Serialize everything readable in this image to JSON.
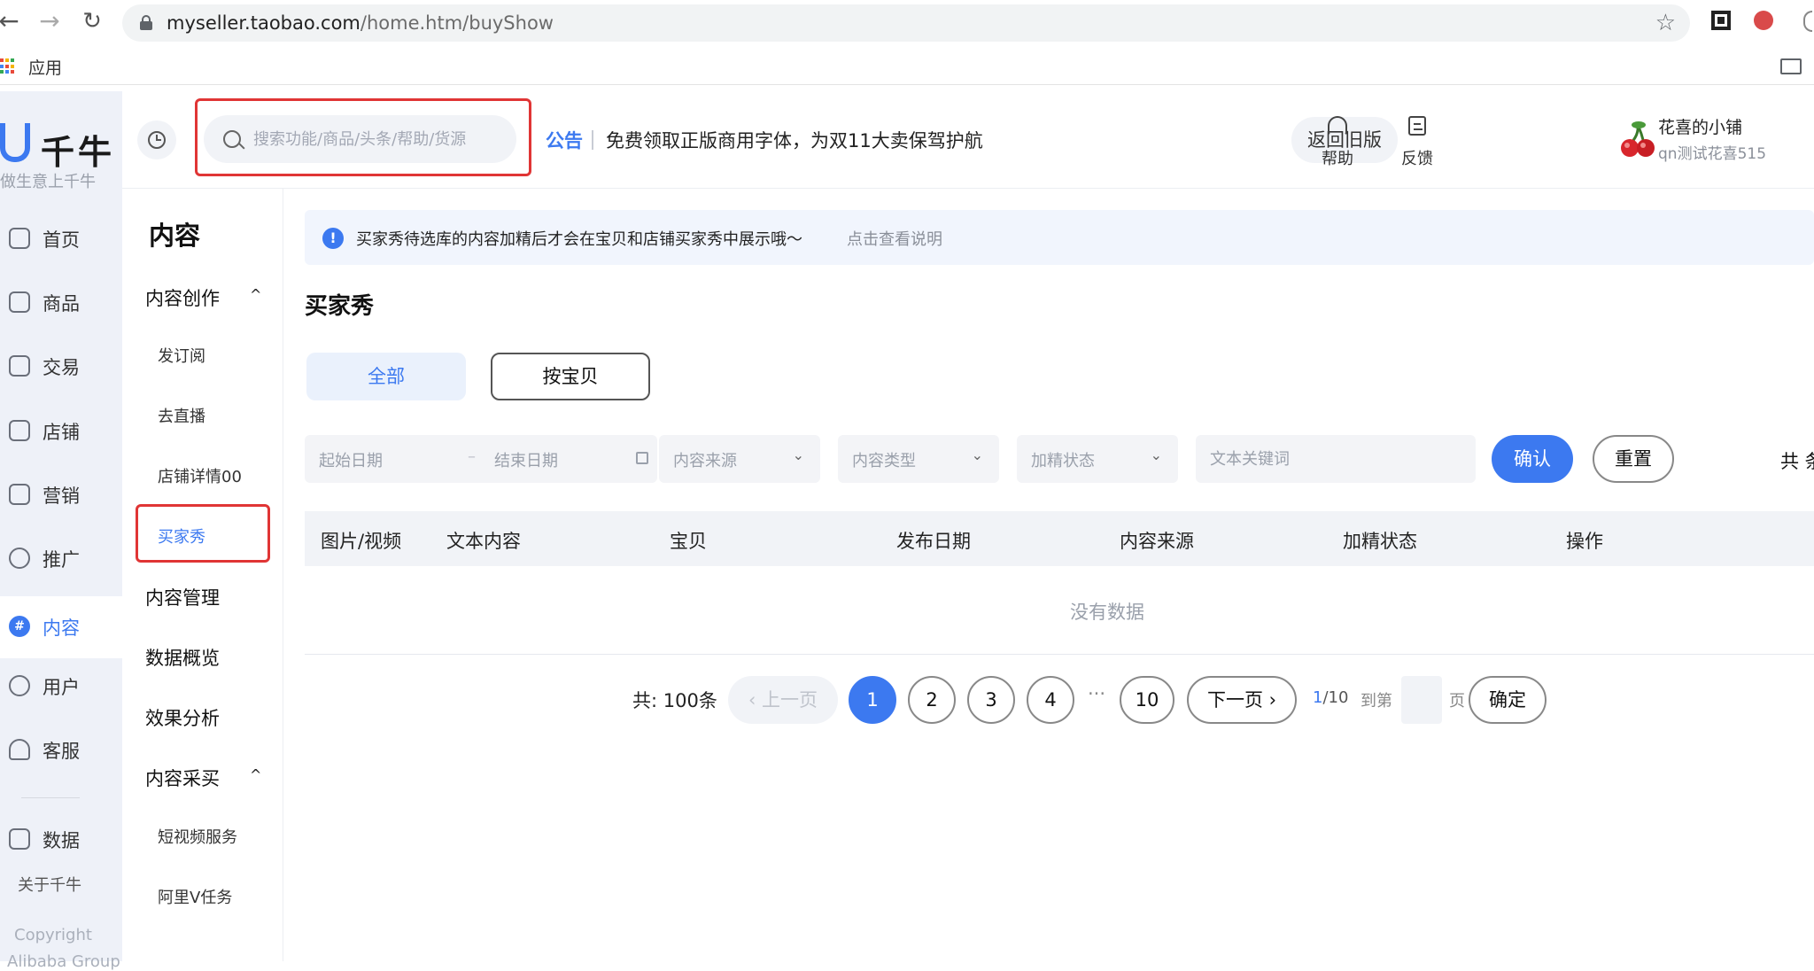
{
  "browser": {
    "url_host": "myseller.taobao.com",
    "url_path": "/home.htm/buyShow",
    "bookmarks_apps_label": "应用"
  },
  "rail": {
    "logo_name": "千牛",
    "slogan": "做生意上千牛",
    "items": [
      {
        "label": "首页",
        "icon": "home-icon"
      },
      {
        "label": "商品",
        "icon": "product-icon"
      },
      {
        "label": "交易",
        "icon": "trade-icon"
      },
      {
        "label": "店铺",
        "icon": "shop-icon"
      },
      {
        "label": "营销",
        "icon": "megaphone-icon"
      },
      {
        "label": "推广",
        "icon": "bulb-icon"
      },
      {
        "label": "内容",
        "icon": "hash-icon",
        "active": true
      },
      {
        "label": "用户",
        "icon": "user-icon"
      },
      {
        "label": "客服",
        "icon": "headset-icon"
      },
      {
        "label": "数据",
        "icon": "chart-icon"
      }
    ],
    "about": "关于千牛",
    "copyright": "Copyright",
    "copyright2": "Alibaba Group"
  },
  "header": {
    "search_placeholder": "搜索功能/商品/头条/帮助/货源",
    "notice_tag": "公告",
    "notice_text": "免费领取正版商用字体，为双11大卖保驾护航",
    "old_version": "返回旧版",
    "help": "帮助",
    "feedback": "反馈",
    "shop_name": "花喜的小铺",
    "shop_account": "qn测试花喜515"
  },
  "subnav": {
    "title": "内容",
    "groups": [
      {
        "label": "内容创作",
        "expanded": true
      },
      {
        "label": "内容管理"
      },
      {
        "label": "数据概览"
      },
      {
        "label": "效果分析"
      },
      {
        "label": "内容采买",
        "expanded": true
      }
    ],
    "items": {
      "subscribe": "发订阅",
      "live": "去直播",
      "shop_detail": "店铺详情00",
      "buyer_show": "买家秀",
      "short_video": "短视频服务",
      "v_task": "阿里V任务"
    }
  },
  "main": {
    "banner_text": "买家秀待选库的内容加精后才会在宝贝和店铺买家秀中展示哦～",
    "banner_link": "点击查看说明",
    "section_title": "买家秀",
    "segments": {
      "all": "全部",
      "by_item": "按宝贝"
    },
    "filters": {
      "start_date": "起始日期",
      "end_date": "结束日期",
      "source": "内容来源",
      "type": "内容类型",
      "featured": "加精状态",
      "keyword": "文本关键词"
    },
    "confirm": "确认",
    "reset": "重置",
    "total_cut": "共 条",
    "columns": [
      "图片/视频",
      "文本内容",
      "宝贝",
      "发布日期",
      "内容来源",
      "加精状态",
      "操作"
    ],
    "empty": "没有数据"
  },
  "pagination": {
    "total": "共: 100条",
    "prev": "上一页",
    "pages": [
      "1",
      "2",
      "3",
      "4"
    ],
    "ellipsis": "···",
    "last": "10",
    "next": "下一页",
    "current": "1",
    "of": "/10",
    "goto": "到第",
    "page_unit": "页",
    "confirm": "确定"
  },
  "colors": {
    "accent": "#3c79f0",
    "highlight_border": "#e03535",
    "rail_bg": "#eef1f8"
  }
}
